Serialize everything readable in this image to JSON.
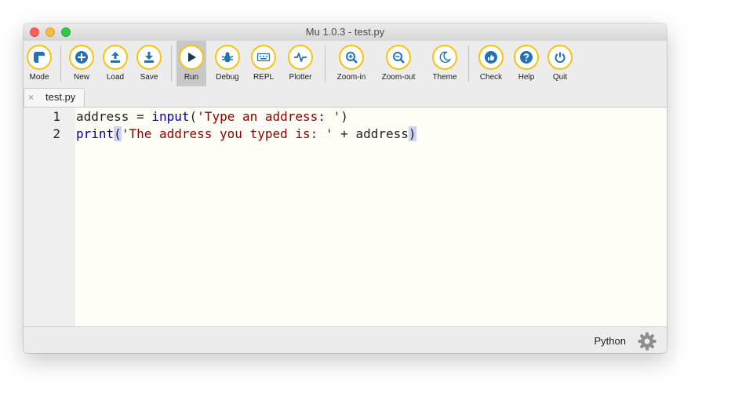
{
  "window": {
    "title": "Mu 1.0.3 - test.py"
  },
  "toolbar": {
    "buttons": [
      {
        "label": "Mode",
        "icon": "mode-icon"
      },
      {
        "label": "New",
        "icon": "plus-icon"
      },
      {
        "label": "Load",
        "icon": "upload-icon"
      },
      {
        "label": "Save",
        "icon": "download-icon"
      },
      {
        "label": "Run",
        "icon": "play-icon"
      },
      {
        "label": "Debug",
        "icon": "bug-icon"
      },
      {
        "label": "REPL",
        "icon": "keyboard-icon"
      },
      {
        "label": "Plotter",
        "icon": "pulse-icon"
      },
      {
        "label": "Zoom-in",
        "icon": "zoom-in-icon"
      },
      {
        "label": "Zoom-out",
        "icon": "zoom-out-icon"
      },
      {
        "label": "Theme",
        "icon": "moon-icon"
      },
      {
        "label": "Check",
        "icon": "thumbs-up-icon"
      },
      {
        "label": "Help",
        "icon": "question-icon"
      },
      {
        "label": "Quit",
        "icon": "power-icon"
      }
    ],
    "active": "Run",
    "accent": "#f6c40e",
    "icon_color": "#2271b3"
  },
  "tabs": [
    {
      "title": "test.py",
      "close": "×"
    }
  ],
  "editor": {
    "lines": [
      {
        "number": "1",
        "text": "address = input('Type an address: ')"
      },
      {
        "number": "2",
        "text": "print('The address you typed is: ' + address)"
      }
    ]
  },
  "status": {
    "mode": "Python",
    "settings_icon": "gear-icon"
  }
}
